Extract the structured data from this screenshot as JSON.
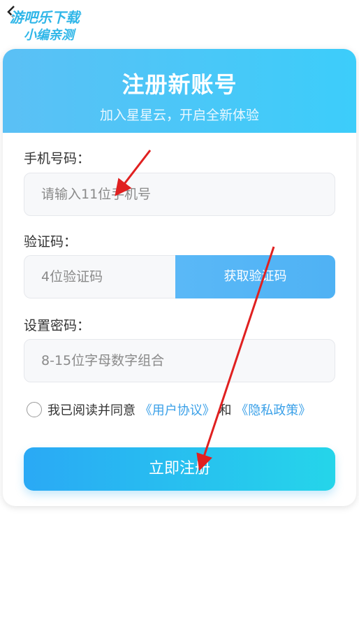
{
  "nav": {
    "back_icon": "chevron-left-icon"
  },
  "watermark": {
    "line1": "游吧乐下载",
    "line2": "小编亲测"
  },
  "header": {
    "title": "注册新账号",
    "subtitle": "加入星星云，开启全新体验"
  },
  "form": {
    "phone": {
      "label": "手机号码：",
      "placeholder": "请输入11位手机号"
    },
    "code": {
      "label": "验证码：",
      "placeholder": "4位验证码",
      "button": "获取验证码"
    },
    "password": {
      "label": "设置密码：",
      "placeholder": "8-15位字母数字组合"
    },
    "agreement": {
      "prefix": "我已阅读并同意",
      "user_agreement": "《用户协议》",
      "and": "和",
      "privacy_policy": "《隐私政策》"
    },
    "submit": "立即注册"
  },
  "colors": {
    "header_gradient_start": "#5bc0f5",
    "header_gradient_end": "#3ccdfa",
    "link": "#3aa0e8",
    "arrow": "#e02020"
  }
}
